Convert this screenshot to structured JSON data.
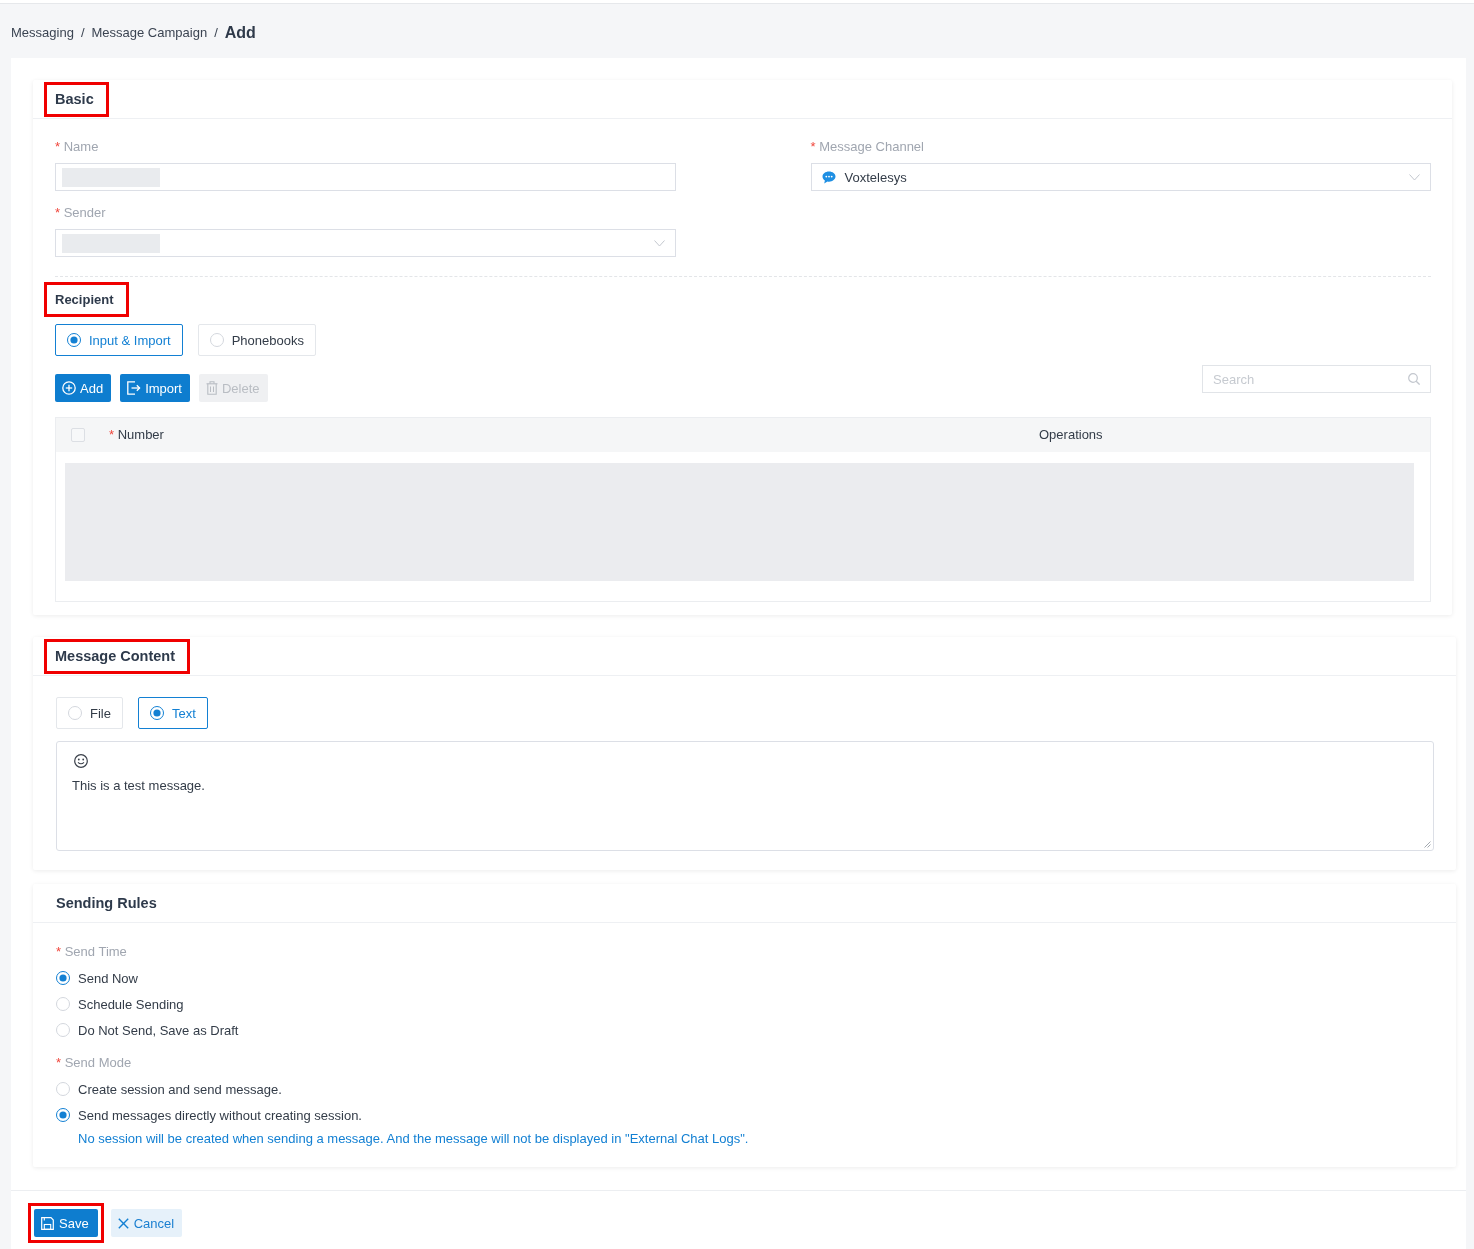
{
  "breadcrumb": [
    {
      "label": "Messaging",
      "current": false,
      "separator": "/"
    },
    {
      "label": "Message Campaign",
      "current": false,
      "separator": "/"
    },
    {
      "label": "Add",
      "current": true
    }
  ],
  "basic": {
    "title": "Basic",
    "highlighted": true,
    "fields": [
      {
        "kind": "input",
        "mark": "*",
        "label": "Name",
        "redacted": true
      },
      {
        "kind": "channel_select",
        "mark": "*",
        "label": "Message Channel",
        "value": "Voxtelesys"
      },
      {
        "kind": "select",
        "mark": "*",
        "label": "Sender",
        "redacted": true
      }
    ],
    "recipient": {
      "title": "Recipient",
      "highlighted": true,
      "source_options": [
        {
          "label": "Input & Import",
          "selected": true
        },
        {
          "label": "Phonebooks",
          "selected": false
        }
      ],
      "actions": [
        {
          "kind": "add",
          "label": "Add",
          "disabled": false
        },
        {
          "kind": "import",
          "label": "Import",
          "disabled": false
        },
        {
          "kind": "delete",
          "label": "Delete",
          "disabled": true
        }
      ],
      "search": {
        "placeholder": "Search"
      },
      "table": {
        "select_all": {
          "checked": false
        },
        "columns": [
          {
            "mark": "*",
            "label": "Number"
          },
          {
            "label": "Operations"
          }
        ],
        "body_redacted": true
      }
    }
  },
  "message_content": {
    "title": "Message Content",
    "highlighted": true,
    "type_options": [
      {
        "label": "File",
        "selected": false
      },
      {
        "label": "Text",
        "selected": true
      }
    ],
    "editor": {
      "value": "This is a test message."
    }
  },
  "sending_rules": {
    "title": "Sending Rules",
    "highlighted": false,
    "groups": [
      {
        "mark": "*",
        "label": "Send Time",
        "options": [
          {
            "label": "Send Now",
            "selected": true
          },
          {
            "label": "Schedule Sending",
            "selected": false
          },
          {
            "label": "Do Not Send, Save as Draft",
            "selected": false
          }
        ]
      },
      {
        "mark": "*",
        "label": "Send Mode",
        "options": [
          {
            "label": "Create session and send message.",
            "selected": false
          },
          {
            "label": "Send messages directly without creating session.",
            "selected": true,
            "hint": "No session will be created when sending a message. And the message will not be displayed in \"External Chat Logs\"."
          }
        ]
      }
    ]
  },
  "footer": {
    "buttons": [
      {
        "kind": "save",
        "label": "Save",
        "highlighted": true
      },
      {
        "kind": "cancel",
        "label": "Cancel",
        "highlighted": false
      }
    ]
  }
}
